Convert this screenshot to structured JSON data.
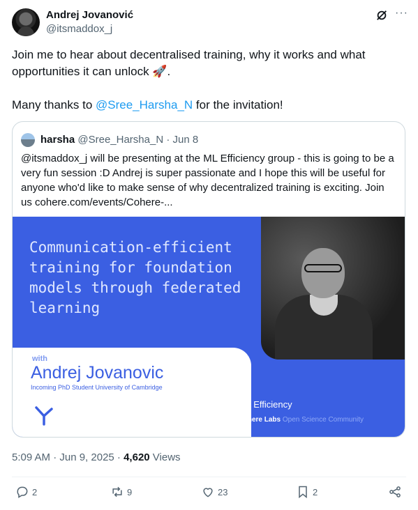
{
  "author": {
    "name": "Andrej Jovanović",
    "handle": "@itsmaddox_j"
  },
  "post": {
    "line1": "Join me to hear about decentralised training, why it works and what opportunities it can unlock 🚀.",
    "thanks_prefix": "Many thanks to ",
    "thanks_mention": "@Sree_Harsha_N",
    "thanks_suffix": " for the invitation!"
  },
  "quote": {
    "name": "harsha",
    "handle": "@Sree_Harsha_N",
    "date": "· Jun 8",
    "text": "@itsmaddox_j will be presenting at the ML Efficiency group - this is going to be a very fun session :D Andrej is super passionate and I hope this will be useful for anyone who'd like to make sense of why decentralized training is exciting. Join us cohere.com/events/Cohere-...",
    "card": {
      "title": "Communication-efficient training for foundation models through federated learning",
      "with_label": "with",
      "speaker": "Andrej Jovanovic",
      "speaker_role": "Incoming PhD Student University of Cambridge",
      "group": "ML Efficiency",
      "org": "Cohere Labs",
      "org_suffix": "Open Science Community"
    }
  },
  "meta": {
    "time": "5:09 AM · Jun 9, 2025 · ",
    "views_count": "4,620",
    "views_label": " Views"
  },
  "actions": {
    "replies": "2",
    "reposts": "9",
    "likes": "23",
    "bookmarks": "2"
  },
  "colors": {
    "accent": "#1d9bf0",
    "card_blue": "#3b5fe2",
    "muted": "#536471"
  }
}
